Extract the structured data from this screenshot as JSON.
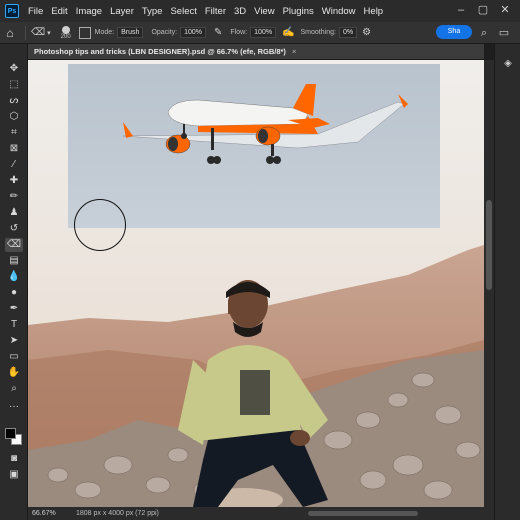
{
  "menubar": {
    "logo": "Ps",
    "items": [
      "File",
      "Edit",
      "Image",
      "Layer",
      "Type",
      "Select",
      "Filter",
      "3D",
      "View",
      "Plugins",
      "Window",
      "Help"
    ]
  },
  "options_bar": {
    "brush_size": "200",
    "mode_label": "Mode:",
    "mode_value": "Brush",
    "opacity_label": "Opacity:",
    "opacity_value": "100%",
    "flow_label": "Flow:",
    "flow_value": "100%",
    "smoothing_label": "Smoothing:",
    "smoothing_value": "0%",
    "share_label": "Sha"
  },
  "document": {
    "tab_title": "Photoshop tips and tricks (LBN DESIGNER).psd @ 66.7% (efe, RGB/8*)",
    "close": "×"
  },
  "statusbar": {
    "zoom": "66.67%",
    "info": "1808 px x 4000 px (72 ppi)"
  },
  "colors": {
    "accent": "#1473e6",
    "plane_orange": "#ff6600"
  }
}
